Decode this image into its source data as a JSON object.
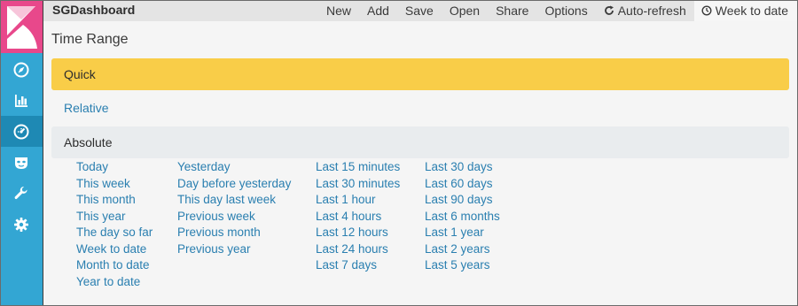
{
  "app": {
    "title": "SGDashboard"
  },
  "menu": [
    {
      "label": "New"
    },
    {
      "label": "Add"
    },
    {
      "label": "Save"
    },
    {
      "label": "Open"
    },
    {
      "label": "Share"
    },
    {
      "label": "Options"
    },
    {
      "label": "Auto-refresh",
      "icon": "refresh-icon"
    },
    {
      "label": "Week to date",
      "icon": "clock-icon"
    }
  ],
  "sidebar": {
    "items": [
      {
        "icon": "compass-icon"
      },
      {
        "icon": "bar-chart-icon"
      },
      {
        "icon": "dashboard-gauge-icon",
        "active": true
      },
      {
        "icon": "mask-icon"
      },
      {
        "icon": "wrench-icon"
      },
      {
        "icon": "gear-icon"
      }
    ]
  },
  "panel": {
    "title": "Time Range",
    "sections": {
      "quick": "Quick",
      "relative": "Relative",
      "absolute": "Absolute"
    }
  },
  "quick_ranges": {
    "col1": [
      "Today",
      "This week",
      "This month",
      "This year",
      "The day so far",
      "Week to date",
      "Month to date",
      "Year to date"
    ],
    "col2": [
      "Yesterday",
      "Day before yesterday",
      "This day last week",
      "Previous week",
      "Previous month",
      "Previous year"
    ],
    "col3": [
      "Last 15 minutes",
      "Last 30 minutes",
      "Last 1 hour",
      "Last 4 hours",
      "Last 12 hours",
      "Last 24 hours",
      "Last 7 days"
    ],
    "col4": [
      "Last 30 days",
      "Last 60 days",
      "Last 90 days",
      "Last 6 months",
      "Last 1 year",
      "Last 2 years",
      "Last 5 years"
    ]
  },
  "colors": {
    "sidebar": "#33a6d3",
    "logo": "#e8488b",
    "quick_highlight": "#f9cd48",
    "link": "#2a7fb0"
  }
}
